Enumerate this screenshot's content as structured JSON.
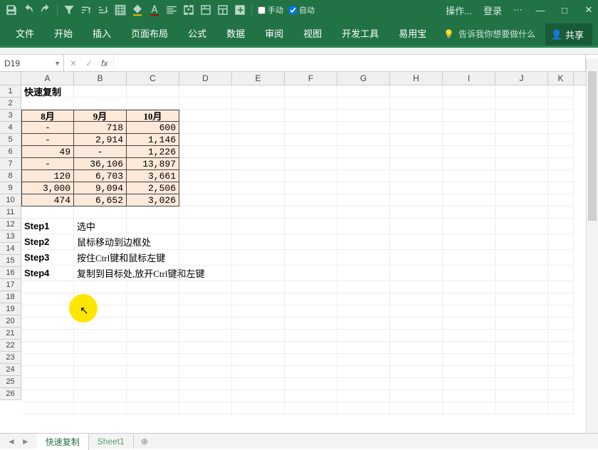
{
  "titlebar": {
    "cb1": "手动",
    "cb2": "自动",
    "ops": "操作...",
    "login": "登录",
    "menu": "⋯"
  },
  "ribbon": {
    "tabs": [
      "文件",
      "开始",
      "插入",
      "页面布局",
      "公式",
      "数据",
      "审阅",
      "视图",
      "开发工具",
      "易用宝"
    ],
    "tellme": "告诉我你想要做什么",
    "share": "共享"
  },
  "fbar": {
    "name": "D19",
    "fx": "fx",
    "formula": ""
  },
  "cols": [
    "A",
    "B",
    "C",
    "D",
    "E",
    "F",
    "G",
    "H",
    "I",
    "J",
    "K"
  ],
  "rownums": [
    1,
    2,
    3,
    4,
    5,
    6,
    7,
    8,
    9,
    10,
    11,
    12,
    13,
    14,
    15,
    16,
    17,
    18,
    19,
    20,
    21,
    22,
    23,
    24,
    25,
    26
  ],
  "title": "快速复制",
  "table": {
    "headers": [
      "8月",
      "9月",
      "10月"
    ],
    "rows": [
      [
        "-",
        "718",
        "600"
      ],
      [
        "-",
        "2,914",
        "1,146"
      ],
      [
        "49",
        "-",
        "1,226"
      ],
      [
        "-",
        "36,106",
        "13,897"
      ],
      [
        "120",
        "6,703",
        "3,661"
      ],
      [
        "3,000",
        "9,094",
        "2,506"
      ],
      [
        "474",
        "6,652",
        "3,026"
      ]
    ]
  },
  "steps": [
    {
      "label": "Step1",
      "desc": "选中"
    },
    {
      "label": "Step2",
      "desc": "鼠标移动到边框处"
    },
    {
      "label": "Step3",
      "desc": "按住Ctrl键和鼠标左键"
    },
    {
      "label": "Step4",
      "desc": "复制到目标处,放开Ctrl键和左键"
    }
  ],
  "sheets": {
    "active": "快速复制",
    "other": "Sheet1"
  }
}
